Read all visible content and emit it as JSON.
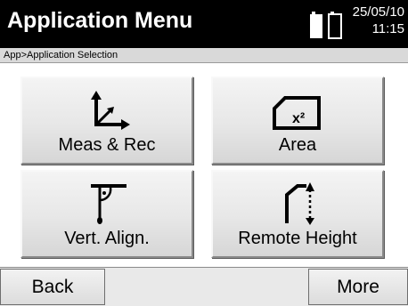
{
  "header": {
    "title": "Application Menu",
    "date": "25/05/10",
    "time": "11:15"
  },
  "breadcrumb": "App>Application Selection",
  "tiles": [
    {
      "label": "Meas & Rec",
      "icon": "measure-record-icon"
    },
    {
      "label": "Area",
      "icon": "area-icon"
    },
    {
      "label": "Vert. Align.",
      "icon": "vertical-alignment-icon"
    },
    {
      "label": "Remote Height",
      "icon": "remote-height-icon"
    }
  ],
  "softkeys": {
    "back": "Back",
    "more": "More"
  }
}
